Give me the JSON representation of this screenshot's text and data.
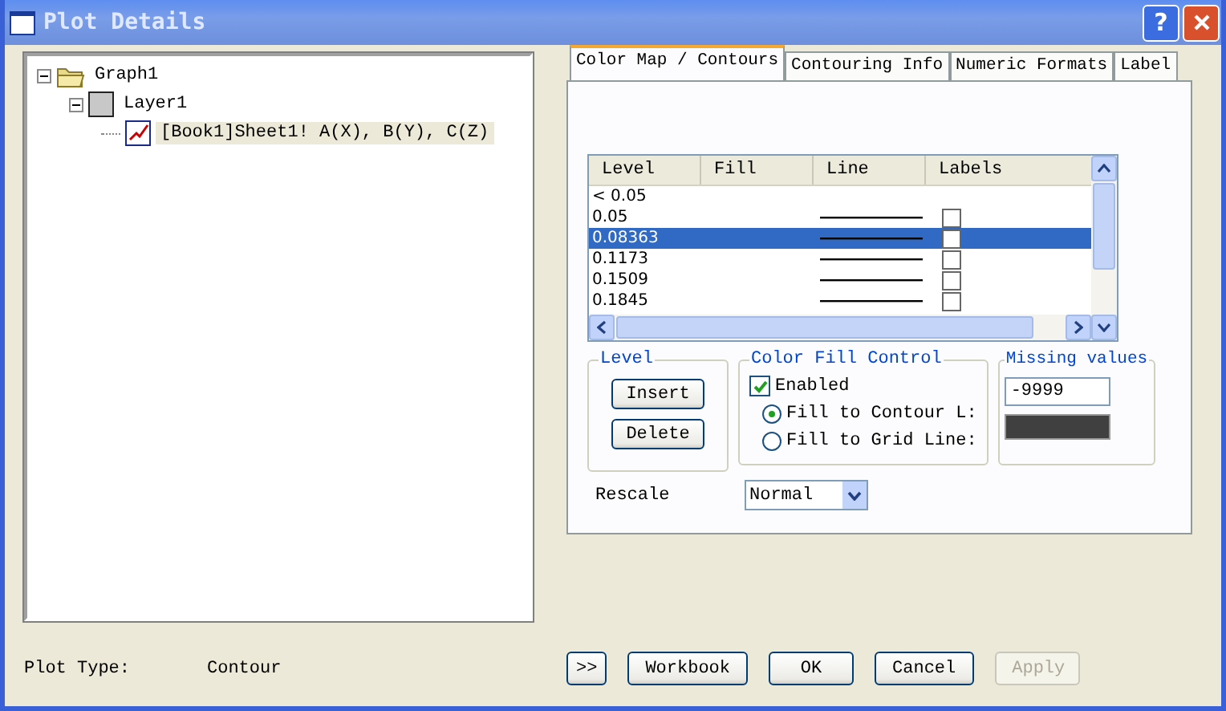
{
  "window": {
    "title": "Plot Details",
    "help_glyph": "?"
  },
  "tree": [
    {
      "label": "Graph1",
      "kind": "graph",
      "expanded": true,
      "selected": false,
      "children": [
        {
          "label": "Layer1",
          "kind": "layer",
          "expanded": true,
          "selected": false,
          "children": [
            {
              "label": "[Book1]Sheet1! A(X), B(Y), C(Z)",
              "kind": "plot",
              "selected": true
            }
          ]
        }
      ]
    }
  ],
  "tabs": [
    {
      "label": "Color Map / Contours",
      "selected": true
    },
    {
      "label": "Contouring Info",
      "selected": false
    },
    {
      "label": "Numeric Formats",
      "selected": false
    },
    {
      "label": "Label",
      "selected": false
    }
  ],
  "levels_table": {
    "columns": [
      "Level",
      "Fill",
      "Line",
      "Labels"
    ],
    "rows": [
      {
        "level": "< 0.05",
        "kind": "below",
        "selected": false
      },
      {
        "level": "0.05",
        "kind": "level",
        "selected": false,
        "label_checked": false
      },
      {
        "level": "0.08363",
        "kind": "level",
        "selected": true,
        "label_checked": false
      },
      {
        "level": "0.1173",
        "kind": "level",
        "selected": false,
        "label_checked": false
      },
      {
        "level": "0.1509",
        "kind": "level",
        "selected": false,
        "label_checked": false
      },
      {
        "level": "0.1845",
        "kind": "level",
        "selected": false,
        "label_checked": false
      }
    ]
  },
  "level_group": {
    "title": "Level",
    "buttons": [
      "Insert",
      "Delete"
    ]
  },
  "color_fill_control": {
    "title": "Color Fill Control",
    "enabled": {
      "label": "Enabled",
      "checked": true
    },
    "options": [
      {
        "label": "Fill to Contour L:",
        "selected": true
      },
      {
        "label": "Fill to Grid Line:",
        "selected": false
      }
    ]
  },
  "missing_values": {
    "title": "Missing values",
    "value": "-9999",
    "color": "#404040"
  },
  "rescale": {
    "label": "Rescale",
    "value": "Normal"
  },
  "plot_type": {
    "label": "Plot Type:",
    "value": "Contour"
  },
  "buttons": [
    {
      "label": ">>",
      "disabled": false
    },
    {
      "label": "Workbook",
      "disabled": false
    },
    {
      "label": "OK",
      "disabled": false
    },
    {
      "label": "Cancel",
      "disabled": false
    },
    {
      "label": "Apply",
      "disabled": true
    }
  ]
}
